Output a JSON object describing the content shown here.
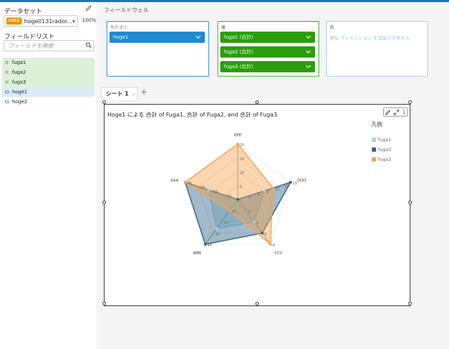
{
  "sidebar": {
    "dataset_title": "データセット",
    "dataset_badge": "SPICE",
    "dataset_name": "hoge0131rador...",
    "dataset_percent": "100%",
    "fieldlist_title": "フィールドリスト",
    "search_placeholder": "フィールドを検索",
    "fields": [
      {
        "label": "fuga1",
        "kind": "measure"
      },
      {
        "label": "fuga2",
        "kind": "measure"
      },
      {
        "label": "fuga3",
        "kind": "measure"
      },
      {
        "label": "hoge1",
        "kind": "dimension-selected"
      },
      {
        "label": "hoge2",
        "kind": "dimension"
      }
    ]
  },
  "fieldwell": {
    "title": "フィールドウェル",
    "category_label": "カテゴリ",
    "category_pill": "hoge1",
    "value_label": "値",
    "value_pills": [
      "fuga1 (合計)",
      "fuga2 (合計)",
      "fuga3 (合計)"
    ],
    "color_label": "色",
    "color_empty": "現在 ディメンション を追加できません"
  },
  "sheet": {
    "tab_label": "シート 1",
    "add_label": "+"
  },
  "visual": {
    "title": "Hoge1 による 合計 of Fuga1, 合計 of Fuga2, and 合計 of Fuga3",
    "legend_title": "凡例",
    "tool_icons": [
      "pencil-icon",
      "expand-icon",
      "more-icon"
    ]
  },
  "colors": {
    "fuga1": "#a6d3ec",
    "fuga2": "#2f6485",
    "fuga3": "#f5a350",
    "measure_bg": "#dff0d8",
    "dimension_bg": "#d9ecf8",
    "category_well": "#2a8fd8",
    "value_well": "#37b11e"
  },
  "chart_data": {
    "type": "radar",
    "title": "Hoge1 による 合計 of Fuga1, 合計 of Fuga2, and 合計 of Fuga3",
    "categories": [
      "EEE",
      "DDD",
      "CCC",
      "BBB",
      "AAA"
    ],
    "axis_max": [
      20,
      18,
      8,
      40,
      40
    ],
    "axis_ticks": [
      [
        5,
        10,
        15,
        20
      ],
      [
        3,
        6,
        9,
        12,
        15,
        18
      ],
      [
        2,
        4,
        6,
        8
      ],
      [
        10,
        20,
        30,
        40
      ],
      [
        10,
        20,
        30,
        40
      ]
    ],
    "legend_position": "top-right",
    "series": [
      {
        "name": "fuga1",
        "values": [
          0,
          9,
          4,
          26,
          22
        ]
      },
      {
        "name": "fuga2",
        "values": [
          0,
          18,
          6,
          40,
          40
        ]
      },
      {
        "name": "fuga3",
        "values": [
          20,
          12,
          8,
          10,
          40
        ]
      }
    ]
  }
}
